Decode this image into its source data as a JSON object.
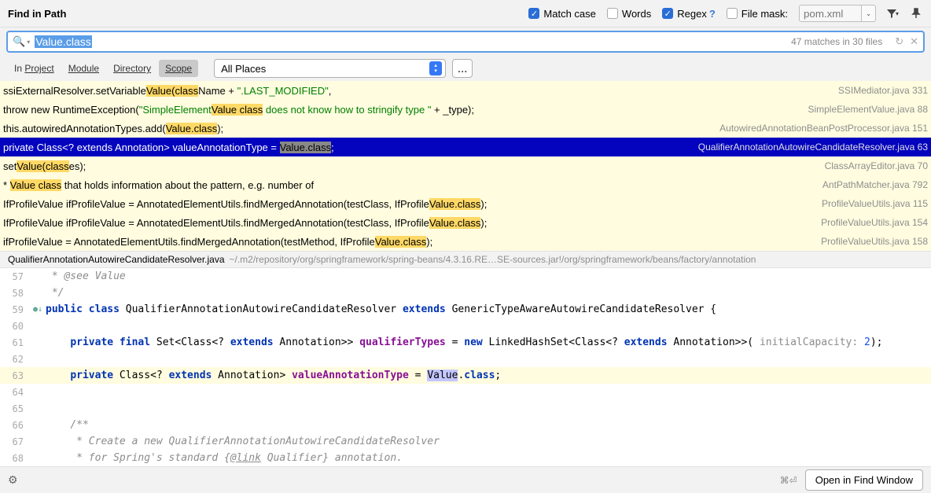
{
  "title": "Find in Path",
  "options": {
    "match_case": "Match case",
    "words": "Words",
    "regex": "Regex",
    "file_mask": "File mask:",
    "file_mask_value": "pom.xml"
  },
  "search": {
    "query": "Value.class",
    "match_count": "47 matches in 30 files"
  },
  "tabs": {
    "project": "Project",
    "module": "Module",
    "directory": "Directory",
    "scope": "Scope"
  },
  "scope_value": "All Places",
  "results": [
    {
      "file": "SSIMediator.java",
      "line": "331"
    },
    {
      "file": "SimpleElementValue.java",
      "line": "88"
    },
    {
      "file": "AutowiredAnnotationBeanPostProcessor.java",
      "line": "151"
    },
    {
      "file": "QualifierAnnotationAutowireCandidateResolver.java",
      "line": "63"
    },
    {
      "file": "ClassArrayEditor.java",
      "line": "70"
    },
    {
      "file": "AntPathMatcher.java",
      "line": "792"
    },
    {
      "file": "ProfileValueUtils.java",
      "line": "115"
    },
    {
      "file": "ProfileValueUtils.java",
      "line": "154"
    },
    {
      "file": "ProfileValueUtils.java",
      "line": "158"
    }
  ],
  "preview": {
    "filename": "QualifierAnnotationAutowireCandidateResolver.java",
    "filepath": "~/.m2/repository/org/springframework/spring-beans/4.3.16.RE…SE-sources.jar!/org/springframework/beans/factory/annotation"
  },
  "editor_lines": {
    "l57": "57",
    "l58": "58",
    "l59": "59",
    "l60": "60",
    "l61": "61",
    "l62": "62",
    "l63": "63",
    "l64": "64",
    "l65": "65",
    "l66": "66",
    "l67": "67",
    "l68": "68"
  },
  "code": {
    "c57": " * @see Value",
    "c58": " */",
    "c60": "",
    "c62": "",
    "c64": "",
    "c65": "",
    "c66": "/**",
    "c67": " * Create a new QualifierAnnotationAutowireCandidateResolver",
    "c68_a": " * for Spring's standard {",
    "c68_b": "@link",
    "c68_c": " Qualifier} annotation."
  },
  "footer": {
    "shortcut": "⌘⏎",
    "open_btn": "Open in Find Window"
  }
}
